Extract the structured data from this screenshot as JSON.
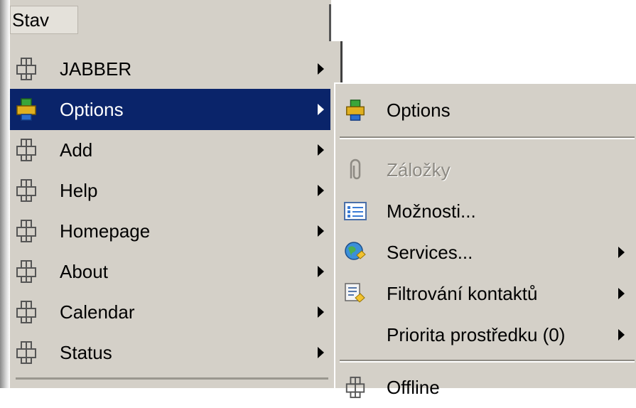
{
  "menubar": {
    "title": "Stav"
  },
  "left_menu": {
    "items": [
      {
        "label": "JABBER",
        "icon": "plugin-icon"
      },
      {
        "label": "Options",
        "icon": "plugin-color-icon",
        "selected": true
      },
      {
        "label": "Add",
        "icon": "plugin-icon"
      },
      {
        "label": "Help",
        "icon": "plugin-icon"
      },
      {
        "label": "Homepage",
        "icon": "plugin-icon"
      },
      {
        "label": "About",
        "icon": "plugin-icon"
      },
      {
        "label": "Calendar",
        "icon": "plugin-icon"
      },
      {
        "label": "Status",
        "icon": "plugin-icon"
      }
    ]
  },
  "submenu": {
    "items": [
      {
        "label": "Options",
        "icon": "plugin-color-icon"
      },
      {
        "label": "Záložky",
        "icon": "paperclip-icon",
        "disabled": true
      },
      {
        "label": "Možnosti...",
        "icon": "settings-list-icon"
      },
      {
        "label": "Services...",
        "icon": "globe-icon",
        "has_submenu": true
      },
      {
        "label": "Filtrování kontaktů",
        "icon": "filter-icon",
        "has_submenu": true
      },
      {
        "label": "Priorita prostředku (0)",
        "has_submenu": true
      },
      {
        "label": "Offline",
        "icon": "plugin-icon"
      }
    ]
  },
  "colors": {
    "menu_bg": "#d4d0c8",
    "selection_bg": "#0a246a",
    "selection_text": "#ffffff",
    "disabled_text": "#8d8a83"
  }
}
